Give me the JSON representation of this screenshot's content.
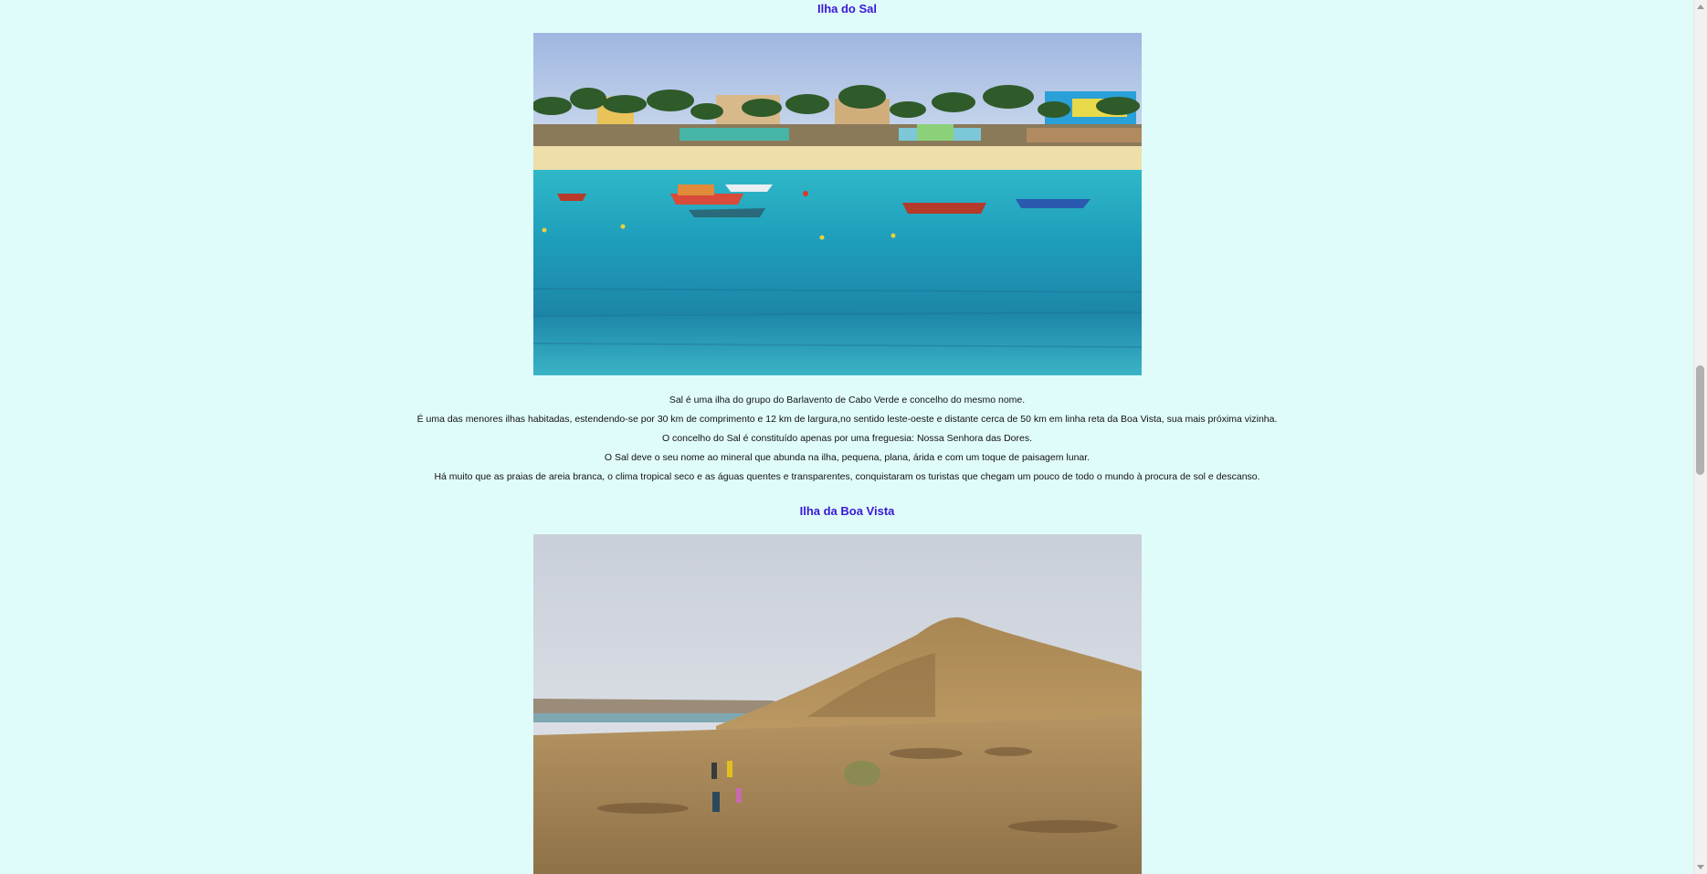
{
  "sections": [
    {
      "title": "Ilha do Sal",
      "paragraphs": [
        "Sal é uma ilha do grupo do Barlavento de Cabo Verde e concelho do mesmo nome.",
        "É uma das menores ilhas habitadas, estendendo-se por 30 km de comprimento e 12 km de largura,no sentido leste-oeste e distante cerca de 50 km em linha reta da Boa Vista, sua mais próxima vizinha.",
        "O concelho do Sal é constituído apenas por uma freguesia: Nossa Senhora das Dores.",
        "O Sal deve o seu nome ao mineral que abunda na ilha, pequena, plana, árida e com um toque de paisagem lunar.",
        "Há muito que as praias de areia branca, o clima tropical seco e as águas quentes e transparentes, conquistaram os turistas que chegam um pouco de todo o mundo à procura de sol e descanso."
      ]
    },
    {
      "title": "Ilha da Boa Vista"
    }
  ],
  "colors": {
    "page_background": "#e0fcfa",
    "title": "#3a17d6"
  },
  "icons": {
    "scroll_up": "triangle-up-icon",
    "scroll_down": "triangle-down-icon"
  }
}
